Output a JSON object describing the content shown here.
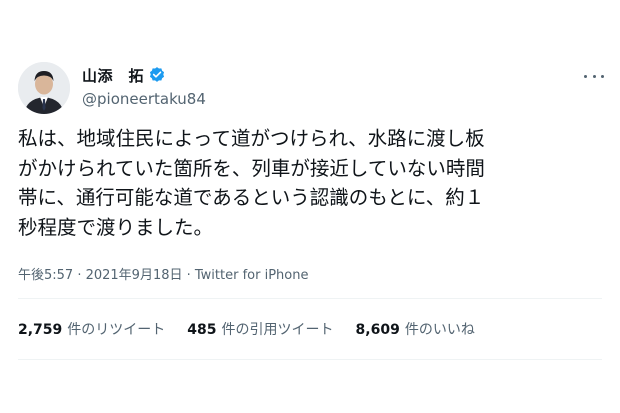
{
  "author": {
    "display_name": "山添　拓",
    "handle": "@pioneertaku84",
    "verified": true
  },
  "tweet": {
    "lines": [
      "私は、地域住民によって道がつけられ、水路に渡し板",
      "がかけられていた箇所を、列車が接近していない時間",
      "帯に、通行可能な道であるという認識のもとに、約１",
      "秒程度で渡りました。"
    ],
    "meta": "午後5:57 · 2021年9月18日 · Twitter for iPhone"
  },
  "stats": {
    "retweets": {
      "count": "2,759",
      "label": "件のリツイート"
    },
    "quotes": {
      "count": "485",
      "label": "件の引用ツイート"
    },
    "likes": {
      "count": "8,609",
      "label": "件のいいね"
    }
  },
  "colors": {
    "verified": "#1d9bf0",
    "secondary_text": "#536471"
  },
  "icons": {
    "verified": "verified-badge-icon",
    "more": "more-dots-icon"
  }
}
